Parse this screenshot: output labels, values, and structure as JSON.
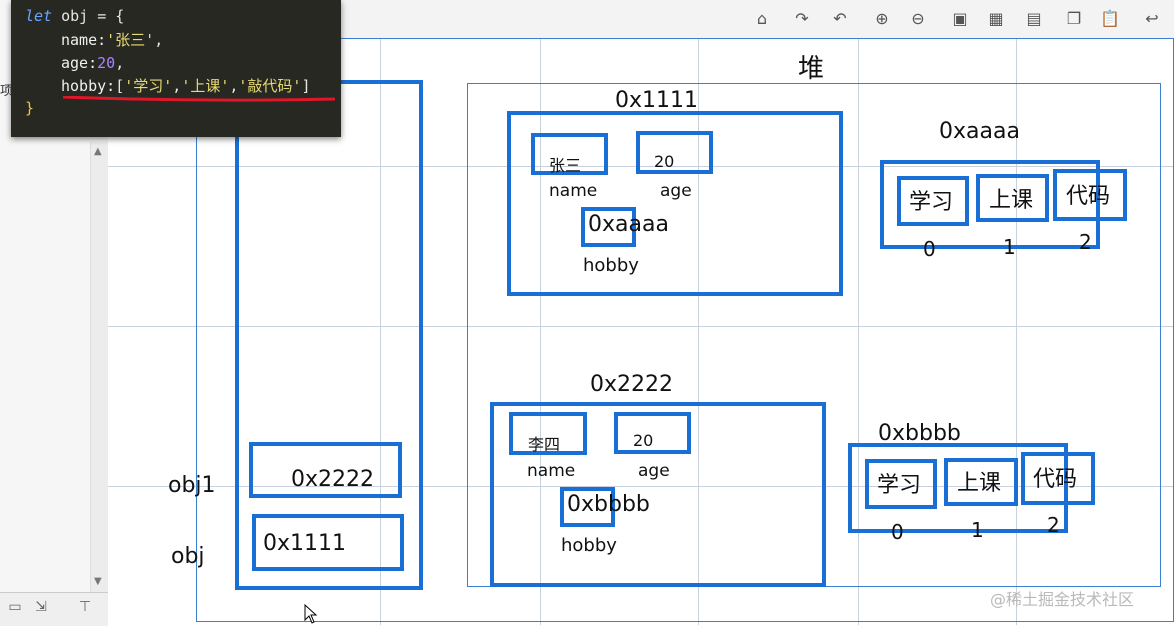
{
  "code": {
    "line1_kw": "let",
    "line1_rest": " obj = {",
    "line2_prop": "name:",
    "line2_val": "'张三'",
    "line2_end": ",",
    "line3_prop": "age:",
    "line3_val": "20",
    "line3_end": ",",
    "line4_prop": "hobby:",
    "line4_open": "[",
    "line4_v1": "'学习'",
    "line4_v2": "'上课'",
    "line4_v3": "'敲代码'",
    "line4_close": "]",
    "line5": "}"
  },
  "diagram": {
    "heap_title": "堆",
    "stack_vars": {
      "obj1_label": "obj1",
      "obj1_value": "0x2222",
      "obj_label": "obj",
      "obj_value": "0x1111"
    },
    "object1": {
      "address": "0x1111",
      "name_value": "张三",
      "name_key": "name",
      "age_value": "20",
      "age_key": "age",
      "hobby_value": "0xaaaa",
      "hobby_key": "hobby"
    },
    "array1": {
      "address": "0xaaaa",
      "items": [
        "学习",
        "上课",
        "代码"
      ],
      "indices": [
        "0",
        "1",
        "2"
      ]
    },
    "object2": {
      "address": "0x2222",
      "name_value": "李四",
      "name_key": "name",
      "age_value": "20",
      "age_key": "age",
      "hobby_value": "0xbbbb",
      "hobby_key": "hobby"
    },
    "array2": {
      "address": "0xbbbb",
      "items": [
        "学习",
        "上课",
        "代码"
      ],
      "indices": [
        "0",
        "1",
        "2"
      ]
    }
  },
  "left_pane": {
    "edge_text": "项"
  },
  "watermark": "@稀土掘金技术社区",
  "colors": {
    "box_blue": "#1a6fd4",
    "underline_red": "#e0162b",
    "code_bg": "#272822"
  }
}
